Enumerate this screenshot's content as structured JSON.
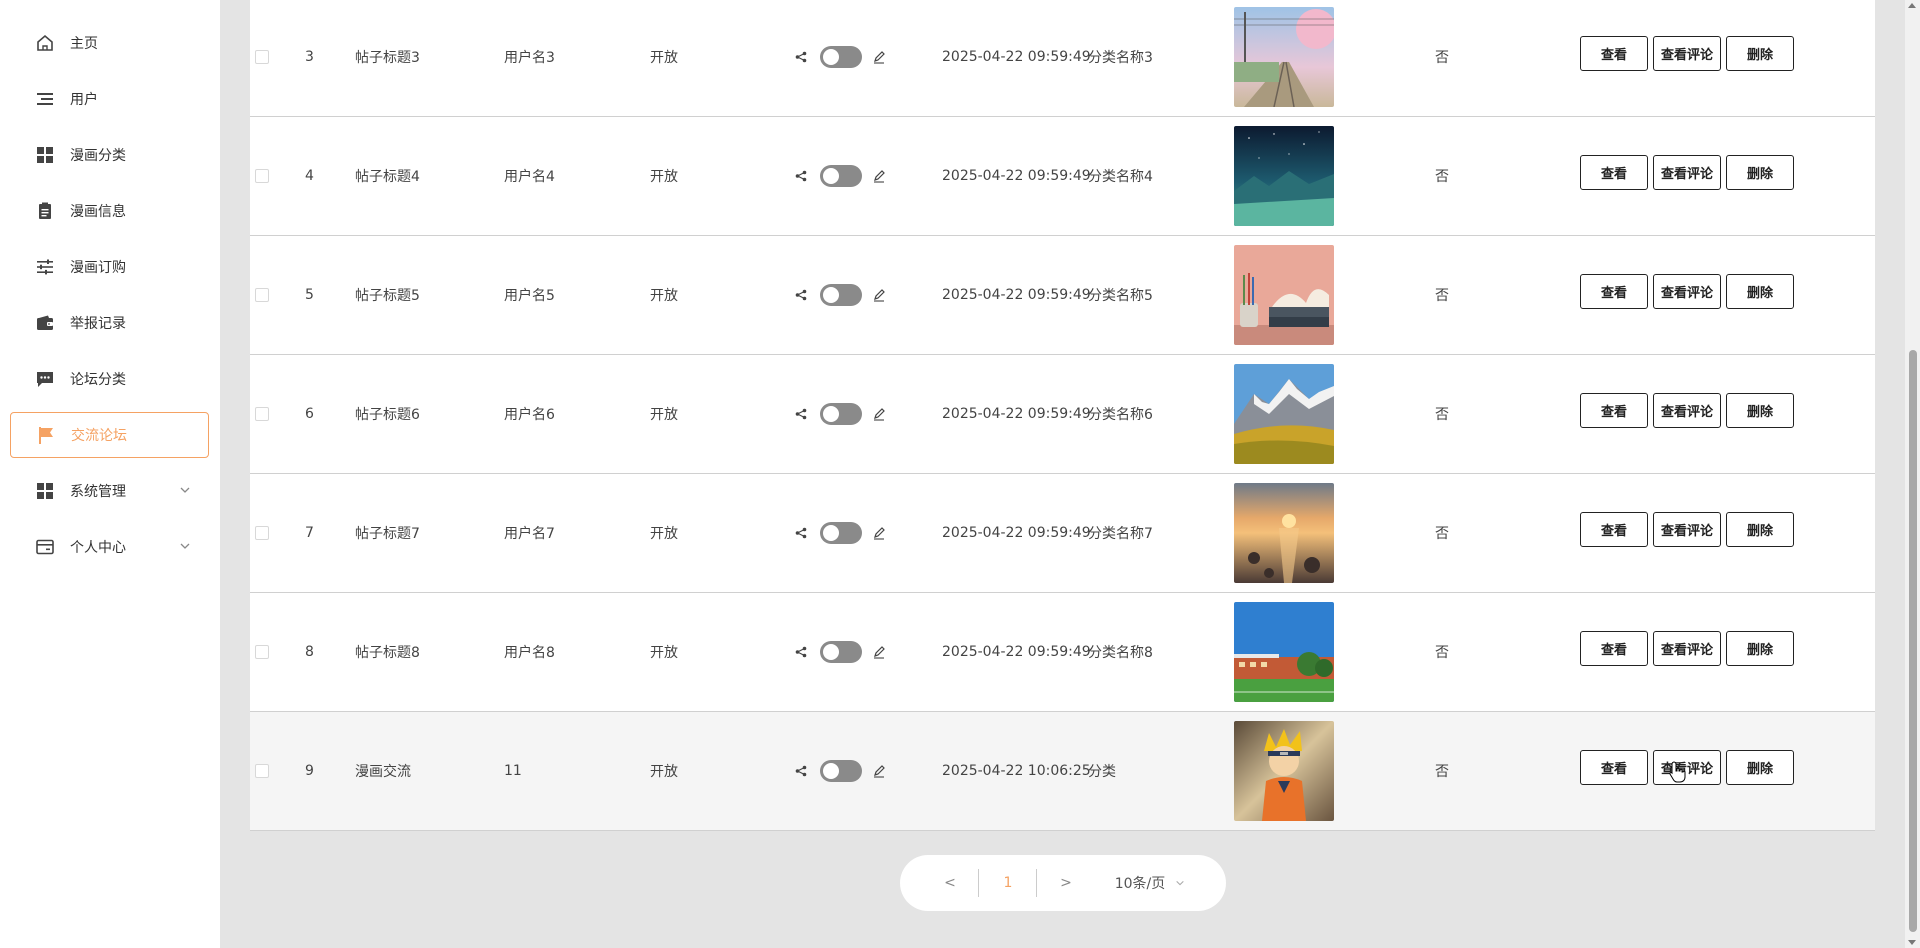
{
  "sidebar": {
    "items": [
      {
        "label": "主页",
        "icon": "home-icon"
      },
      {
        "label": "用户",
        "icon": "list-icon"
      },
      {
        "label": "漫画分类",
        "icon": "grid-icon"
      },
      {
        "label": "漫画信息",
        "icon": "clipboard-icon"
      },
      {
        "label": "漫画订购",
        "icon": "sliders-icon"
      },
      {
        "label": "举报记录",
        "icon": "wallet-icon"
      },
      {
        "label": "论坛分类",
        "icon": "chat-icon"
      },
      {
        "label": "交流论坛",
        "icon": "flag-icon",
        "active": true
      },
      {
        "label": "系统管理",
        "icon": "grid-icon",
        "expandable": true
      },
      {
        "label": "个人中心",
        "icon": "card-icon",
        "expandable": true
      }
    ]
  },
  "table": {
    "rows": [
      {
        "index": "3",
        "title": "帖子标题3",
        "user": "用户名3",
        "status": "开放",
        "time": "2025-04-22 09:59:49",
        "category": "分类名称3",
        "image": "rail-sunset-image",
        "flag": "否"
      },
      {
        "index": "4",
        "title": "帖子标题4",
        "user": "用户名4",
        "status": "开放",
        "time": "2025-04-22 09:59:49",
        "category": "分类名称4",
        "image": "night-sky-image",
        "flag": "否"
      },
      {
        "index": "5",
        "title": "帖子标题5",
        "user": "用户名5",
        "status": "开放",
        "time": "2025-04-22 09:59:49",
        "category": "分类名称5",
        "image": "books-image",
        "flag": "否"
      },
      {
        "index": "6",
        "title": "帖子标题6",
        "user": "用户名6",
        "status": "开放",
        "time": "2025-04-22 09:59:49",
        "category": "分类名称6",
        "image": "mountain-image",
        "flag": "否"
      },
      {
        "index": "7",
        "title": "帖子标题7",
        "user": "用户名7",
        "status": "开放",
        "time": "2025-04-22 09:59:49",
        "category": "分类名称7",
        "image": "sunset-beach-image",
        "flag": "否"
      },
      {
        "index": "8",
        "title": "帖子标题8",
        "user": "用户名8",
        "status": "开放",
        "time": "2025-04-22 09:59:49",
        "category": "分类名称8",
        "image": "campus-image",
        "flag": "否"
      },
      {
        "index": "9",
        "title": "漫画交流",
        "user": "11",
        "status": "开放",
        "time": "2025-04-22 10:06:25",
        "category": "分类",
        "image": "anime-character-image",
        "flag": "否"
      }
    ],
    "actions": {
      "view": "查看",
      "view_comments": "查看评论",
      "delete": "删除"
    }
  },
  "pagination": {
    "prev": "<",
    "current": "1",
    "next": ">",
    "page_size": "10条/页"
  },
  "colors": {
    "accent": "#f5a263",
    "toggle_off": "#8a8a8a",
    "background": "#e4e4e4"
  }
}
